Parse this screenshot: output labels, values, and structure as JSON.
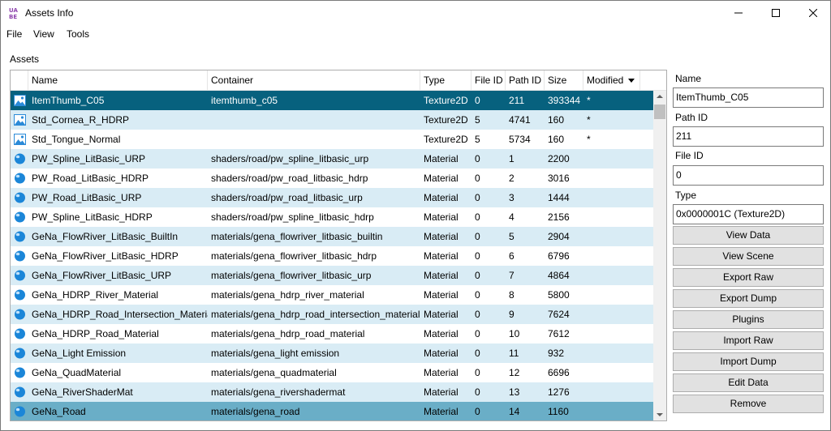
{
  "window": {
    "title": "Assets Info",
    "app_icon": "uabe-logo-icon"
  },
  "titlebar_controls": {
    "minimize": "minimize-icon",
    "maximize": "maximize-icon",
    "close": "close-icon"
  },
  "menu": [
    "File",
    "View",
    "Tools"
  ],
  "assets_label": "Assets",
  "columns": [
    "Name",
    "Container",
    "Type",
    "File ID",
    "Path ID",
    "Size",
    "Modified"
  ],
  "sort_column": "Modified",
  "colors": {
    "row_even": "#ffffff",
    "row_odd": "#d9ecf5",
    "row_selected": "#07617e",
    "row_hover": "#6aaec7",
    "material_icon": "#1b86d8",
    "texture_icon": "#2a8ad8"
  },
  "rows": [
    {
      "icon": "texture-icon",
      "name": "ItemThumb_C05",
      "container": "itemthumb_c05",
      "type": "Texture2D",
      "file_id": "0",
      "path_id": "211",
      "size": "393344",
      "modified": "*",
      "state": "selected"
    },
    {
      "icon": "texture-icon",
      "name": "Std_Cornea_R_HDRP",
      "container": "",
      "type": "Texture2D",
      "file_id": "5",
      "path_id": "4741",
      "size": "160",
      "modified": "*",
      "state": ""
    },
    {
      "icon": "texture-icon",
      "name": "Std_Tongue_Normal",
      "container": "",
      "type": "Texture2D",
      "file_id": "5",
      "path_id": "5734",
      "size": "160",
      "modified": "*",
      "state": ""
    },
    {
      "icon": "material-icon",
      "name": "PW_Spline_LitBasic_URP",
      "container": "shaders/road/pw_spline_litbasic_urp",
      "type": "Material",
      "file_id": "0",
      "path_id": "1",
      "size": "2200",
      "modified": "",
      "state": ""
    },
    {
      "icon": "material-icon",
      "name": "PW_Road_LitBasic_HDRP",
      "container": "shaders/road/pw_road_litbasic_hdrp",
      "type": "Material",
      "file_id": "0",
      "path_id": "2",
      "size": "3016",
      "modified": "",
      "state": ""
    },
    {
      "icon": "material-icon",
      "name": "PW_Road_LitBasic_URP",
      "container": "shaders/road/pw_road_litbasic_urp",
      "type": "Material",
      "file_id": "0",
      "path_id": "3",
      "size": "1444",
      "modified": "",
      "state": ""
    },
    {
      "icon": "material-icon",
      "name": "PW_Spline_LitBasic_HDRP",
      "container": "shaders/road/pw_spline_litbasic_hdrp",
      "type": "Material",
      "file_id": "0",
      "path_id": "4",
      "size": "2156",
      "modified": "",
      "state": ""
    },
    {
      "icon": "material-icon",
      "name": "GeNa_FlowRiver_LitBasic_BuiltIn",
      "container": "materials/gena_flowriver_litbasic_builtin",
      "type": "Material",
      "file_id": "0",
      "path_id": "5",
      "size": "2904",
      "modified": "",
      "state": ""
    },
    {
      "icon": "material-icon",
      "name": "GeNa_FlowRiver_LitBasic_HDRP",
      "container": "materials/gena_flowriver_litbasic_hdrp",
      "type": "Material",
      "file_id": "0",
      "path_id": "6",
      "size": "6796",
      "modified": "",
      "state": ""
    },
    {
      "icon": "material-icon",
      "name": "GeNa_FlowRiver_LitBasic_URP",
      "container": "materials/gena_flowriver_litbasic_urp",
      "type": "Material",
      "file_id": "0",
      "path_id": "7",
      "size": "4864",
      "modified": "",
      "state": ""
    },
    {
      "icon": "material-icon",
      "name": "GeNa_HDRP_River_Material",
      "container": "materials/gena_hdrp_river_material",
      "type": "Material",
      "file_id": "0",
      "path_id": "8",
      "size": "5800",
      "modified": "",
      "state": ""
    },
    {
      "icon": "material-icon",
      "name": "GeNa_HDRP_Road_Intersection_Material",
      "container": "materials/gena_hdrp_road_intersection_material",
      "type": "Material",
      "file_id": "0",
      "path_id": "9",
      "size": "7624",
      "modified": "",
      "state": ""
    },
    {
      "icon": "material-icon",
      "name": "GeNa_HDRP_Road_Material",
      "container": "materials/gena_hdrp_road_material",
      "type": "Material",
      "file_id": "0",
      "path_id": "10",
      "size": "7612",
      "modified": "",
      "state": ""
    },
    {
      "icon": "material-icon",
      "name": "GeNa_Light Emission",
      "container": "materials/gena_light emission",
      "type": "Material",
      "file_id": "0",
      "path_id": "11",
      "size": "932",
      "modified": "",
      "state": ""
    },
    {
      "icon": "material-icon",
      "name": "GeNa_QuadMaterial",
      "container": "materials/gena_quadmaterial",
      "type": "Material",
      "file_id": "0",
      "path_id": "12",
      "size": "6696",
      "modified": "",
      "state": ""
    },
    {
      "icon": "material-icon",
      "name": "GeNa_RiverShaderMat",
      "container": "materials/gena_rivershadermat",
      "type": "Material",
      "file_id": "0",
      "path_id": "13",
      "size": "1276",
      "modified": "",
      "state": ""
    },
    {
      "icon": "material-icon",
      "name": "GeNa_Road",
      "container": "materials/gena_road",
      "type": "Material",
      "file_id": "0",
      "path_id": "14",
      "size": "1160",
      "modified": "",
      "state": "hover"
    }
  ],
  "details": {
    "name_label": "Name",
    "name_value": "ItemThumb_C05",
    "path_id_label": "Path ID",
    "path_id_value": "211",
    "file_id_label": "File ID",
    "file_id_value": "0",
    "type_label": "Type",
    "type_value": "0x0000001C (Texture2D)"
  },
  "buttons": [
    "View Data",
    "View Scene",
    "Export Raw",
    "Export Dump",
    "Plugins",
    "Import Raw",
    "Import Dump",
    "Edit Data",
    "Remove"
  ]
}
